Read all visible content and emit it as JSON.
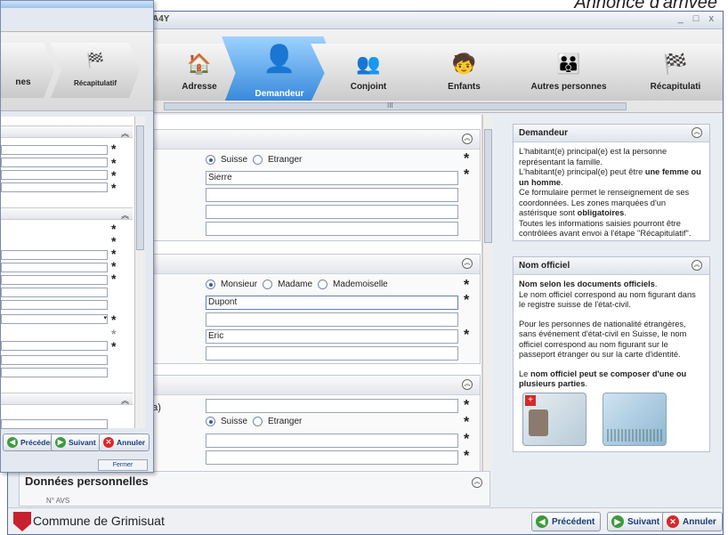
{
  "caption": "Annonce d'arrivée",
  "main_window": {
    "title": "A4Y",
    "controls": "_ □ x",
    "steps": [
      {
        "label": "Adresse",
        "icon": "house-icon"
      },
      {
        "label": "Demandeur",
        "icon": "person-icon",
        "active": true
      },
      {
        "label": "Conjoint",
        "icon": "couple-icon"
      },
      {
        "label": "Enfants",
        "icon": "child-icon"
      },
      {
        "label": "Autres personnes",
        "icon": "group-icon"
      },
      {
        "label": "Récapitulati",
        "icon": "checkered-flag-icon"
      }
    ],
    "hscroll_mark": "III"
  },
  "form": {
    "nationality_options": [
      "Suisse",
      "Etranger"
    ],
    "place_value": "Sierre",
    "salutation_options": [
      "Monsieur",
      "Madame",
      "Mademoiselle"
    ],
    "last_name_value": "Dupont",
    "first_name_value": "Eric",
    "partial_label": "aa)",
    "nationality2_options": [
      "Suisse",
      "Etranger"
    ],
    "personal_section_title": "Données personnelles",
    "personal_partial_label": "N° AVS"
  },
  "help_demandeur": {
    "title": "Demandeur",
    "text_1": "L'habitant(e) principal(e) est la personne représentant la famille.",
    "text_2_pre": "L'habitant(e) principal(e) peut être ",
    "text_2_bold": "une femme ou un homme",
    "text_2_post": ".",
    "text_3": "Ce formulaire permet le renseignement de ses coordonnées. Les zones marquées d'un astérisque sont ",
    "text_3_bold": "obligatoires",
    "text_3_post": ".",
    "text_4": "Toutes les informations saisies pourront être contrôlées avant envoi à l'étape \"Récapitulatif\"."
  },
  "help_nom": {
    "title": "Nom officiel",
    "text_1_bold": "Nom selon les documents officiels",
    "text_1_post": ".",
    "text_2": "Le nom officiel correspond au nom figurant dans le registre suisse de l'état-civil.",
    "text_3": "Pour les personnes de nationalité étrangères, sans événement d'état-civil en Suisse, le nom officiel correspond au nom figurant sur le passeport étranger ou sur la carte d'identité.",
    "text_4_pre": "Le ",
    "text_4_bold": "nom officiel peut se composer d'une ou plusieurs parties",
    "text_4_post": "."
  },
  "footer": {
    "commune": "Commune de Grimisuat",
    "prev": "Précédent",
    "next": "Suivant",
    "cancel": "Annuler"
  },
  "popup": {
    "step_partial": "nes",
    "step_recap": "Récapitulatif",
    "prev": "Précédent",
    "next": "Suivant",
    "cancel": "Annuler",
    "close": "Fermer"
  },
  "colors": {
    "active_step": "#2a7fd6",
    "accent_text": "#1a3a78",
    "cancel_icon": "#d42a2a",
    "nav_icon": "#3e9a3e"
  }
}
